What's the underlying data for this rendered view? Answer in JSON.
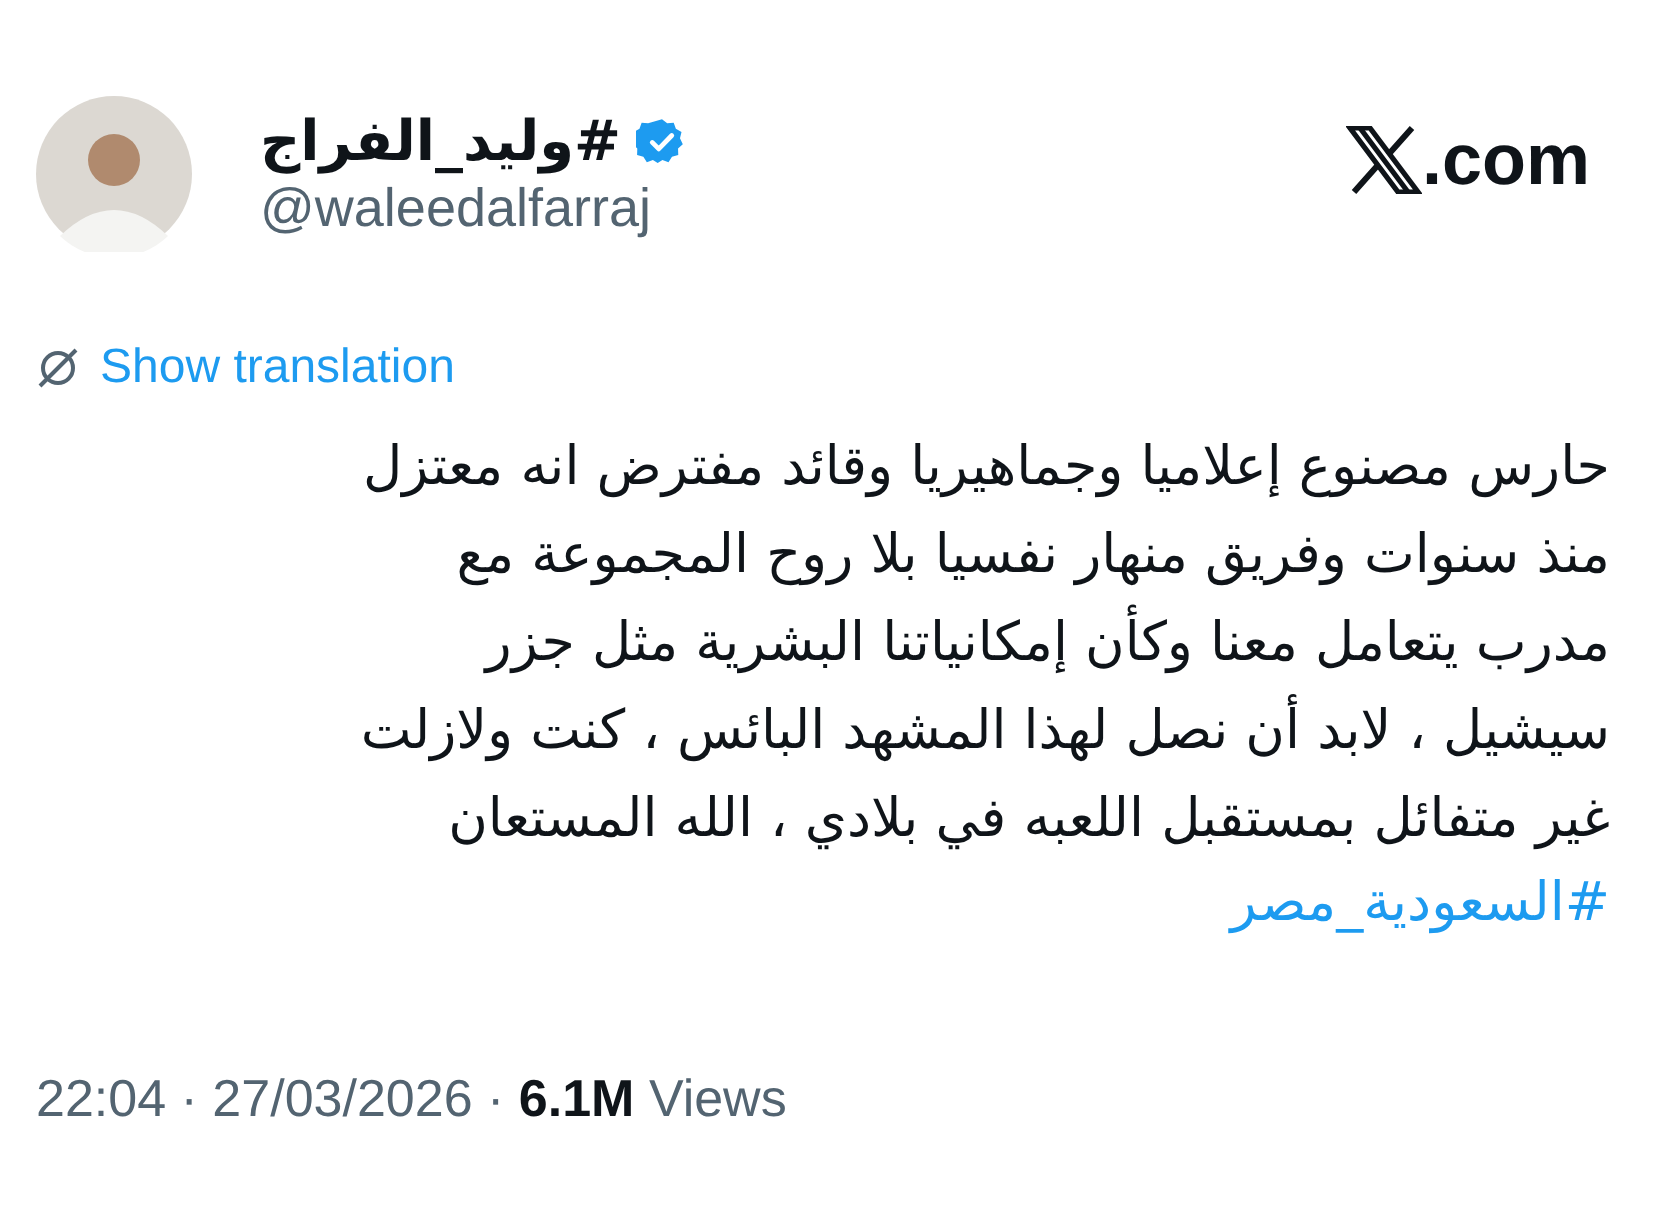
{
  "author": {
    "name": "#وليد_الفراج",
    "verified": true,
    "handle": "@waleedalfarraj"
  },
  "site": {
    "logo_suffix": ".com"
  },
  "translation_link": "Show translation",
  "body": "حارس مصنوع إعلاميا وجماهيريا وقائد مفترض انه معتزل\nمنذ سنوات وفريق منهار نفسيا بلا روح المجموعة مع\nمدرب يتعامل معنا وكأن إمكانياتنا البشرية مثل جزر\nسيشيل ، لابد أن نصل لهذا المشهد البائس ، كنت ولازلت\nغير متفائل بمستقبل اللعبه في بلادي  ، الله المستعان",
  "hashtag": "#السعودية_مصر",
  "meta": "22:04 · 27/03/2026 · **6.1M** Views"
}
